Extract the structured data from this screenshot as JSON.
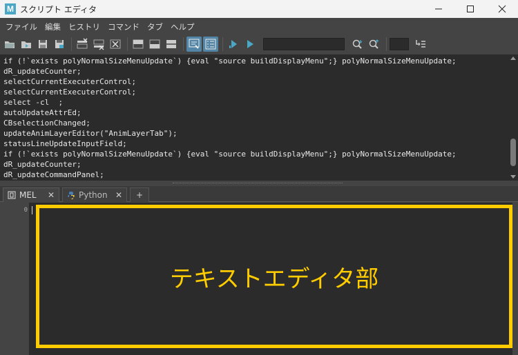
{
  "window": {
    "title": "スクリプト エディタ",
    "logo_letter": "M",
    "controls": {
      "minimize": "—",
      "maximize": "☐",
      "close": "✕"
    }
  },
  "menu": [
    "ファイル",
    "編集",
    "ヒストリ",
    "コマンド",
    "タブ",
    "ヘルプ"
  ],
  "toolbar": {
    "icons": [
      "open-script-icon",
      "source-script-icon",
      "save-script-icon",
      "save-script-to-shelf-icon",
      "clear-history-icon",
      "clear-input-icon",
      "clear-all-icon",
      "show-history-icon",
      "show-input-icon",
      "show-both-icon",
      "echo-all-commands-icon",
      "line-numbers-icon",
      "execute-all-icon",
      "execute-icon",
      "search-icon",
      "search-up-icon",
      "goto-line-icon"
    ],
    "accent": "#5285a6"
  },
  "history": [
    "if (!`exists polyNormalSizeMenuUpdate`) {eval \"source buildDisplayMenu\";} polyNormalSizeMenuUpdate;",
    "dR_updateCounter;",
    "selectCurrentExecuterControl;",
    "selectCurrentExecuterControl;",
    "select -cl  ;",
    "autoUpdateAttrEd;",
    "CBselectionChanged;",
    "updateAnimLayerEditor(\"AnimLayerTab\");",
    "statusLineUpdateInputField;",
    "if (!`exists polyNormalSizeMenuUpdate`) {eval \"source buildDisplayMenu\";} polyNormalSizeMenuUpdate;",
    "dR_updateCounter;",
    "dR_updateCommandPanel;"
  ],
  "tabs": [
    {
      "label": "MEL",
      "close": "✕"
    },
    {
      "label": "Python",
      "close": "✕"
    }
  ],
  "add_tab_label": "+",
  "editor": {
    "line_number": "0",
    "annotation": "テキストエディタ部",
    "annotation_color": "#ffcc00"
  }
}
